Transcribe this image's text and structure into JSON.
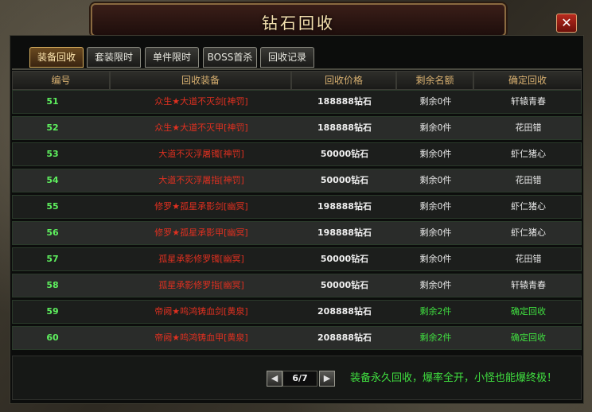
{
  "window": {
    "title": "钻石回收",
    "close_label": "✕"
  },
  "tabs": [
    {
      "label": "装备回收",
      "active": true
    },
    {
      "label": "套装限时",
      "active": false
    },
    {
      "label": "单件限时",
      "active": false
    },
    {
      "label": "BOSS首杀",
      "active": false
    },
    {
      "label": "回收记录",
      "active": false
    }
  ],
  "table": {
    "headers": [
      "编号",
      "回收装备",
      "回收价格",
      "剩余名额",
      "确定回收"
    ],
    "rows": [
      {
        "id": "51",
        "item": "众生★大道不灭剑[神罚]",
        "price": "188888钻石",
        "remaining": "剩余0件",
        "action": "轩辕青春",
        "remaining_available": false
      },
      {
        "id": "52",
        "item": "众生★大道不灭甲[神罚]",
        "price": "188888钻石",
        "remaining": "剩余0件",
        "action": "花田错",
        "remaining_available": false
      },
      {
        "id": "53",
        "item": "大道不灭浮屠镯[神罚]",
        "price": "50000钻石",
        "remaining": "剩余0件",
        "action": "虾仁猪心",
        "remaining_available": false
      },
      {
        "id": "54",
        "item": "大道不灭浮屠指[神罚]",
        "price": "50000钻石",
        "remaining": "剩余0件",
        "action": "花田错",
        "remaining_available": false
      },
      {
        "id": "55",
        "item": "修罗★孤星承影剑[幽冥]",
        "price": "198888钻石",
        "remaining": "剩余0件",
        "action": "虾仁猪心",
        "remaining_available": false
      },
      {
        "id": "56",
        "item": "修罗★孤星承影甲[幽冥]",
        "price": "198888钻石",
        "remaining": "剩余0件",
        "action": "虾仁猪心",
        "remaining_available": false
      },
      {
        "id": "57",
        "item": "孤星承影修罗镯[幽冥]",
        "price": "50000钻石",
        "remaining": "剩余0件",
        "action": "花田错",
        "remaining_available": false
      },
      {
        "id": "58",
        "item": "孤星承影修罗指[幽冥]",
        "price": "50000钻石",
        "remaining": "剩余0件",
        "action": "轩辕青春",
        "remaining_available": false
      },
      {
        "id": "59",
        "item": "帝阙★鸣鸿铸血剑[黄泉]",
        "price": "208888钻石",
        "remaining": "剩余2件",
        "action": "确定回收",
        "remaining_available": true
      },
      {
        "id": "60",
        "item": "帝阙★鸣鸿铸血甲[黄泉]",
        "price": "208888钻石",
        "remaining": "剩余2件",
        "action": "确定回收",
        "remaining_available": true
      }
    ]
  },
  "pager": {
    "prev_label": "◀",
    "page": "6/7",
    "next_label": "▶"
  },
  "footer": {
    "message": "装备永久回收，爆率全开，小怪也能爆终极！"
  },
  "colors": {
    "accent": "#d8b060",
    "item_red": "#e03020",
    "available_green": "#40e040",
    "id_green": "#5ef05e"
  }
}
